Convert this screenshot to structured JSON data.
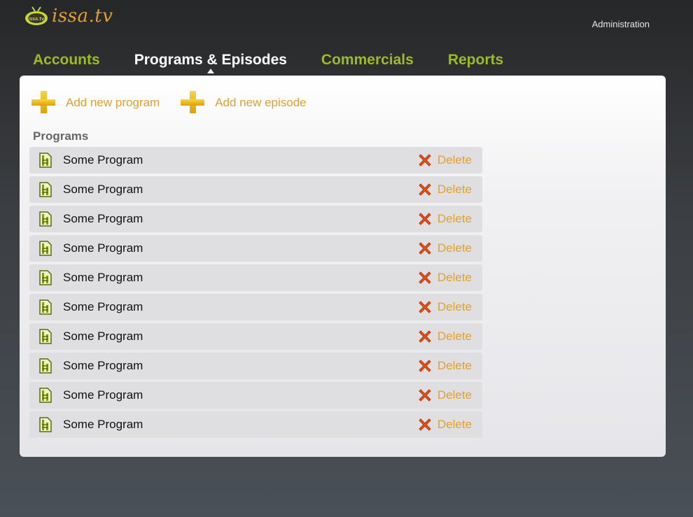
{
  "header": {
    "logo_text": "issa.tv",
    "logo_badge": "issa.tv",
    "admin_link": "Administration"
  },
  "nav": {
    "items": [
      {
        "label": "Accounts",
        "active": false
      },
      {
        "label": "Programs & Episodes",
        "active": true
      },
      {
        "label": "Commercials",
        "active": false
      },
      {
        "label": "Reports",
        "active": false
      }
    ]
  },
  "actions": {
    "add_program": "Add new program",
    "add_episode": "Add new episode"
  },
  "programs": {
    "title": "Programs",
    "delete_label": "Delete",
    "items": [
      "Some Program",
      "Some Program",
      "Some Program",
      "Some Program",
      "Some Program",
      "Some Program",
      "Some Program",
      "Some Program",
      "Some Program",
      "Some Program"
    ]
  },
  "colors": {
    "accent_green": "#9dbc1e",
    "accent_orange": "#e0a030",
    "delete_red": "#e0541c"
  },
  "icons": {
    "logo": "tv-icon",
    "add": "plus-icon",
    "program": "film-file-icon",
    "delete": "x-icon"
  }
}
